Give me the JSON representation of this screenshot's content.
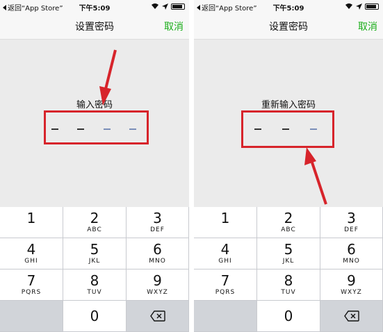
{
  "screens": [
    {
      "status": {
        "back_label": "返回“App Store”",
        "time": "下午5:09"
      },
      "nav": {
        "title": "设置密码",
        "cancel": "取消"
      },
      "prompt": "输入密码",
      "keys": [
        {
          "num": "1",
          "letters": ""
        },
        {
          "num": "2",
          "letters": "ABC"
        },
        {
          "num": "3",
          "letters": "DEF"
        },
        {
          "num": "4",
          "letters": "GHI"
        },
        {
          "num": "5",
          "letters": "JKL"
        },
        {
          "num": "6",
          "letters": "MNO"
        },
        {
          "num": "7",
          "letters": "PQRS"
        },
        {
          "num": "8",
          "letters": "TUV"
        },
        {
          "num": "9",
          "letters": "WXYZ"
        },
        {
          "num": "0",
          "letters": ""
        }
      ]
    },
    {
      "status": {
        "back_label": "返回“App Store”",
        "time": "下午5:09"
      },
      "nav": {
        "title": "设置密码",
        "cancel": "取消"
      },
      "prompt": "重新输入密码",
      "keys": [
        {
          "num": "1",
          "letters": ""
        },
        {
          "num": "2",
          "letters": "ABC"
        },
        {
          "num": "3",
          "letters": "DEF"
        },
        {
          "num": "4",
          "letters": "GHI"
        },
        {
          "num": "5",
          "letters": "JKL"
        },
        {
          "num": "6",
          "letters": "MNO"
        },
        {
          "num": "7",
          "letters": "PQRS"
        },
        {
          "num": "8",
          "letters": "TUV"
        },
        {
          "num": "9",
          "letters": "WXYZ"
        },
        {
          "num": "0",
          "letters": ""
        }
      ]
    }
  ],
  "colors": {
    "accent_green": "#1aad19",
    "annotation_red": "#d7242b",
    "screen_bg": "#ebebeb",
    "keypad_bg": "#d1d4d9"
  },
  "icons": {
    "back": "back-triangle-icon",
    "wifi": "wifi-icon",
    "location": "location-arrow-icon",
    "battery": "battery-icon",
    "delete": "backspace-icon"
  }
}
